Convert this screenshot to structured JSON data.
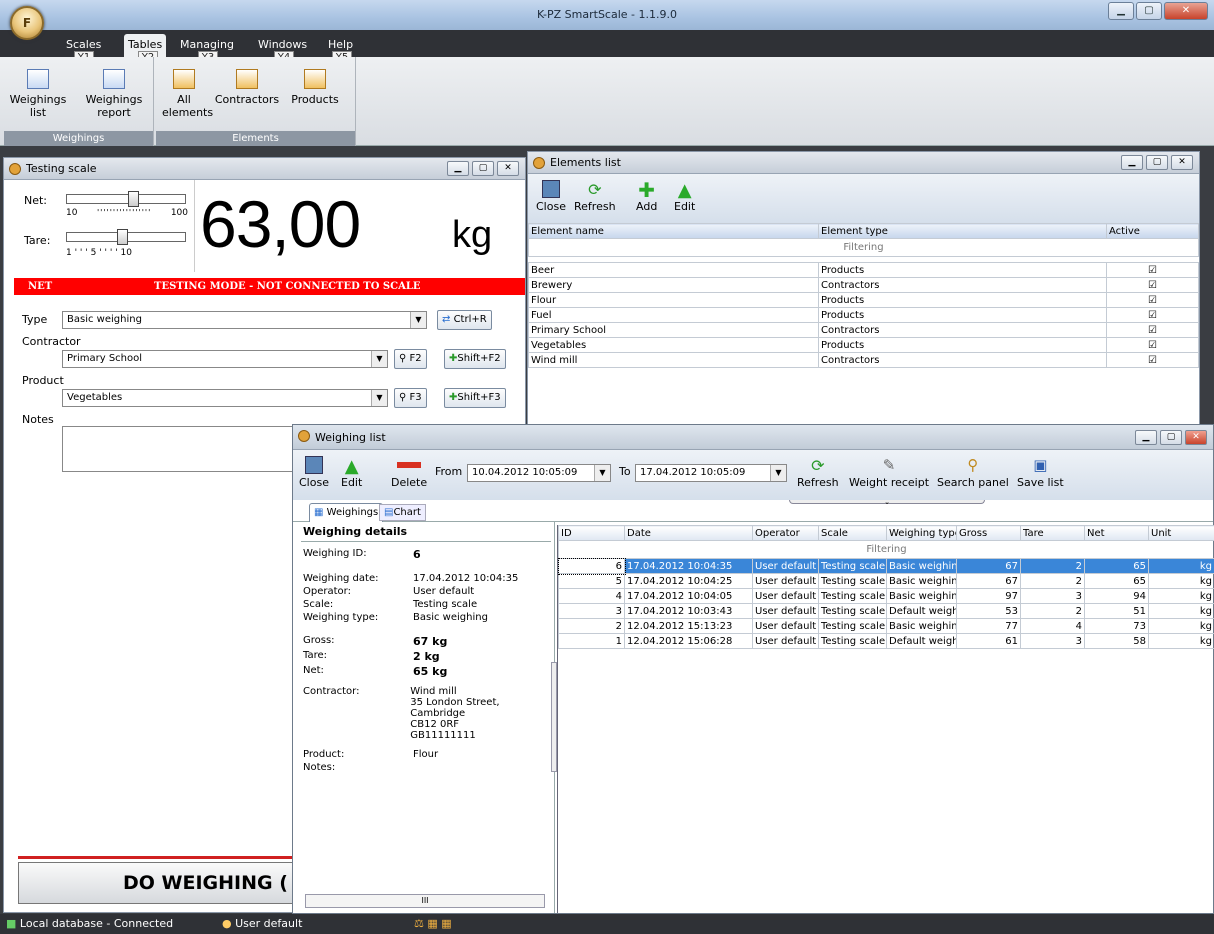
{
  "app": {
    "title": "K-PZ SmartScale - 1.1.9.0",
    "orb": "F"
  },
  "menu": [
    {
      "label": "Scales",
      "key": "Y1"
    },
    {
      "label": "Tables",
      "key": "Y2"
    },
    {
      "label": "Managing",
      "key": "Y3"
    },
    {
      "label": "Windows",
      "key": "Y4"
    },
    {
      "label": "Help",
      "key": "Y5"
    }
  ],
  "ribbon": {
    "weighings_group": "Weighings",
    "elements_group": "Elements",
    "buttons": [
      "Weighings list",
      "Weighings report",
      "All elements",
      "Contractors",
      "Products"
    ]
  },
  "scale": {
    "title": "Testing scale",
    "net_label": "Net:",
    "tare_label": "Tare:",
    "net_min": "10",
    "net_max": "100",
    "tare_ticks": "1 ' ' ' 5 ' ' ' ' 10",
    "net_slider_level": 0.55,
    "tare_slider_level": 0.45,
    "value": "63,00",
    "unit": "kg",
    "mode_left": "NET",
    "mode_text": "TESTING MODE - NOT CONNECTED TO SCALE",
    "type_label": "Type",
    "type_value": "Basic weighing",
    "type_btn": "Ctrl+R",
    "contractor_label": "Contractor",
    "contractor_value": "Primary School",
    "f2": "F2",
    "shiftf2": "Shift+F2",
    "product_label": "Product",
    "product_value": "Vegetables",
    "f3": "F3",
    "shiftf3": "Shift+F3",
    "notes_label": "Notes",
    "do_weighing": "DO WEIGHING ("
  },
  "elements": {
    "title": "Elements list",
    "toolbar": [
      "Close",
      "Refresh",
      "Add",
      "Edit"
    ],
    "columns": [
      "Element name",
      "Element type",
      "Active"
    ],
    "filtering": "Filtering",
    "rows": [
      [
        "Beer",
        "Products"
      ],
      [
        "Brewery",
        "Contractors"
      ],
      [
        "Flour",
        "Products"
      ],
      [
        "Fuel",
        "Products"
      ],
      [
        "Primary School",
        "Contractors"
      ],
      [
        "Vegetables",
        "Products"
      ],
      [
        "Wind mill",
        "Contractors"
      ]
    ],
    "check": "☑"
  },
  "weighing_list": {
    "title": "Weighing list",
    "toolbar": {
      "close": "Close",
      "edit": "Edit",
      "delete": "Delete",
      "from": "From",
      "from_value": "10.04.2012 10:05:09",
      "to": "To",
      "to_value": "17.04.2012 10:05:09",
      "refresh": "Refresh",
      "receipt": "Weight receipt",
      "search": "Search panel",
      "save": "Save list"
    },
    "tabs": [
      "Weighings",
      "Chart"
    ],
    "details_title": "Weighing details",
    "details": [
      {
        "k": "Weighing ID:",
        "v": "6",
        "bold": true
      },
      {
        "k": "Weighing date:",
        "v": "17.04.2012 10:04:35"
      },
      {
        "k": "Operator:",
        "v": "User default"
      },
      {
        "k": "Scale:",
        "v": "Testing scale"
      },
      {
        "k": "Weighing type:",
        "v": "Basic weighing"
      },
      {
        "k": "Gross:",
        "v": "67 kg",
        "bold": true
      },
      {
        "k": "Tare:",
        "v": "2 kg",
        "bold": true
      },
      {
        "k": "Net:",
        "v": "65 kg",
        "bold": true
      },
      {
        "k": "Contractor:",
        "v": "Wind mill\n35 London Street, Cambridge\nCB12 0RF\nGB11111111"
      },
      {
        "k": "Product:",
        "v": "Flour"
      },
      {
        "k": "Notes:",
        "v": ""
      }
    ],
    "scroll_label": "III",
    "columns": [
      "ID",
      "Date",
      "Operator",
      "Scale",
      "Weighing type",
      "Gross",
      "Tare",
      "Net",
      "Unit"
    ],
    "filtering": "Filtering",
    "rows": [
      [
        "6",
        "17.04.2012 10:04:35",
        "User default",
        "Testing scale",
        "Basic weighing",
        "67",
        "2",
        "65",
        "kg"
      ],
      [
        "5",
        "17.04.2012 10:04:25",
        "User default",
        "Testing scale",
        "Basic weighing",
        "67",
        "2",
        "65",
        "kg"
      ],
      [
        "4",
        "17.04.2012 10:04:05",
        "User default",
        "Testing scale",
        "Basic weighing",
        "97",
        "3",
        "94",
        "kg"
      ],
      [
        "3",
        "17.04.2012 10:03:43",
        "User default",
        "Testing scale",
        "Default weighi",
        "53",
        "2",
        "51",
        "kg"
      ],
      [
        "2",
        "12.04.2012 15:13:23",
        "User default",
        "Testing scale",
        "Basic weighing",
        "77",
        "4",
        "73",
        "kg"
      ],
      [
        "1",
        "12.04.2012 15:06:28",
        "User default",
        "Testing scale",
        "Default weighi",
        "61",
        "3",
        "58",
        "kg"
      ]
    ]
  },
  "status": {
    "db": "Local database - Connected",
    "user": "User default"
  }
}
